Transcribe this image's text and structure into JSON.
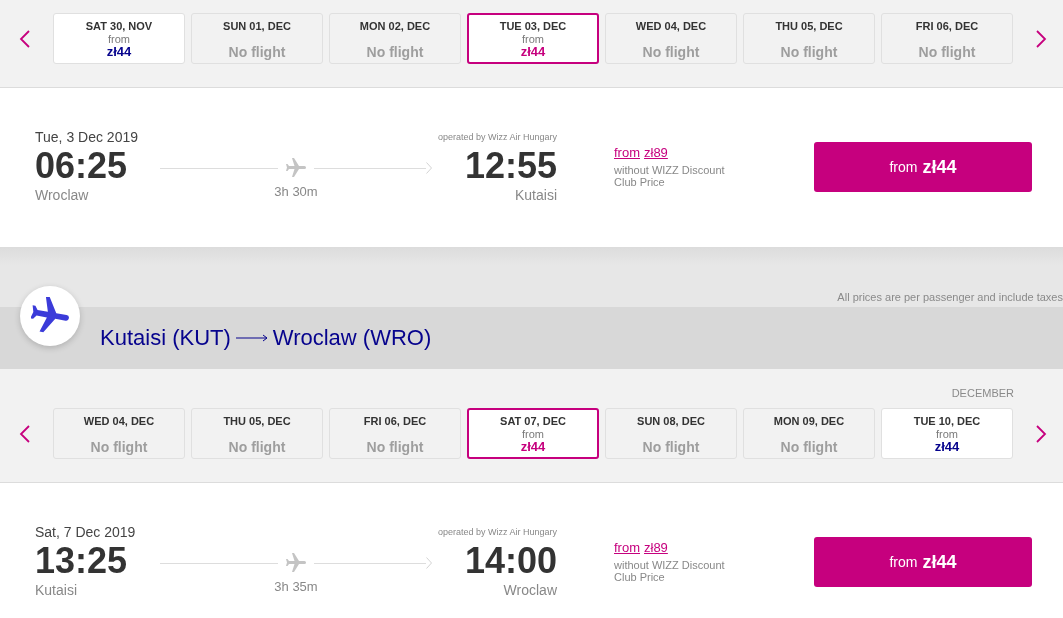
{
  "outbound_flight": {
    "dates": [
      {
        "kind": "fare",
        "day": "SAT 30, NOV",
        "prefix": "from",
        "price": "zł44",
        "selected": false
      },
      {
        "kind": "no_flight",
        "day": "SUN 01, DEC",
        "label": "No flight",
        "selected": false
      },
      {
        "kind": "no_flight",
        "day": "MON 02, DEC",
        "label": "No flight",
        "selected": false
      },
      {
        "kind": "fare",
        "day": "TUE 03, DEC",
        "prefix": "from",
        "price": "zł44",
        "selected": true
      },
      {
        "kind": "no_flight",
        "day": "WED 04, DEC",
        "label": "No flight",
        "selected": false
      },
      {
        "kind": "no_flight",
        "day": "THU 05, DEC",
        "label": "No flight",
        "selected": false
      },
      {
        "kind": "no_flight",
        "day": "FRI 06, DEC",
        "label": "No flight",
        "selected": false
      }
    ],
    "flight": {
      "date": "Tue, 3 Dec 2019",
      "operator": "operated by Wizz Air Hungary",
      "departure": {
        "time": "06:25",
        "city": "Wroclaw"
      },
      "duration": "3h 30m",
      "arrival": {
        "time": "12:55",
        "city": "Kutaisi"
      },
      "club_price": {
        "prefix": "from",
        "price": "zł89",
        "note": "without WIZZ Discount Club Price"
      },
      "select_button": {
        "prefix": "from",
        "price": "zł44"
      }
    }
  },
  "price_note": "All prices are per passenger and include taxes",
  "return_flight": {
    "route": {
      "origin": "Kutaisi (KUT)",
      "destination": "Wroclaw (WRO)"
    },
    "month": "DECEMBER",
    "dates": [
      {
        "kind": "no_flight",
        "day": "WED 04, DEC",
        "label": "No flight",
        "selected": false
      },
      {
        "kind": "no_flight",
        "day": "THU 05, DEC",
        "label": "No flight",
        "selected": false
      },
      {
        "kind": "no_flight",
        "day": "FRI 06, DEC",
        "label": "No flight",
        "selected": false
      },
      {
        "kind": "fare",
        "day": "SAT 07, DEC",
        "prefix": "from",
        "price": "zł44",
        "selected": true
      },
      {
        "kind": "no_flight",
        "day": "SUN 08, DEC",
        "label": "No flight",
        "selected": false
      },
      {
        "kind": "no_flight",
        "day": "MON 09, DEC",
        "label": "No flight",
        "selected": false
      },
      {
        "kind": "fare",
        "day": "TUE 10, DEC",
        "prefix": "from",
        "price": "zł44",
        "selected": false
      }
    ],
    "flight": {
      "date": "Sat, 7 Dec 2019",
      "operator": "operated by Wizz Air Hungary",
      "departure": {
        "time": "13:25",
        "city": "Kutaisi"
      },
      "duration": "3h 35m",
      "arrival": {
        "time": "14:00",
        "city": "Wroclaw"
      },
      "club_price": {
        "prefix": "from",
        "price": "zł89",
        "note": "without WIZZ Discount Club Price"
      },
      "select_button": {
        "prefix": "from",
        "price": "zł44"
      }
    }
  }
}
